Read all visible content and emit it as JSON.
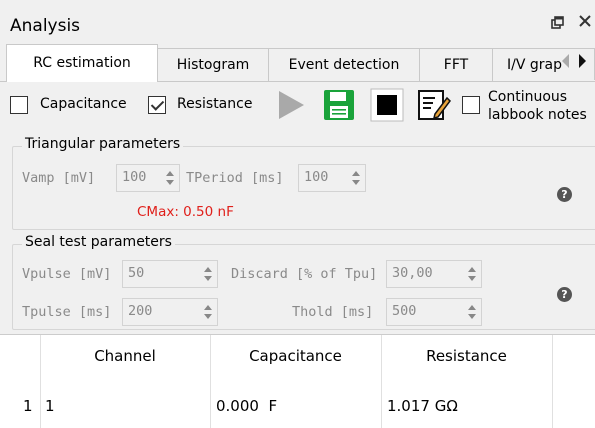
{
  "window": {
    "title": "Analysis",
    "float_icon": "float-icon",
    "close_icon": "close-icon"
  },
  "tabs": [
    {
      "label": "RC estimation",
      "active": true
    },
    {
      "label": "Histogram",
      "active": false
    },
    {
      "label": "Event detection",
      "active": false
    },
    {
      "label": "FFT",
      "active": false
    },
    {
      "label": "I/V grap",
      "active": false
    }
  ],
  "toolbar": {
    "capacitance_label": "Capacitance",
    "capacitance_checked": false,
    "resistance_label": "Resistance",
    "resistance_checked": true,
    "continuous_label_line1": "Continuous",
    "continuous_label_line2": "labbook notes",
    "continuous_checked": false
  },
  "triangular": {
    "title": "Triangular parameters",
    "vamp_label": "Vamp [mV]",
    "vamp_value": "100",
    "tperiod_label": "TPeriod [ms]",
    "tperiod_value": "100",
    "cmax_text": "CMax: 0.50 nF"
  },
  "seal": {
    "title": "Seal test parameters",
    "vpulse_label": "Vpulse [mV]",
    "vpulse_value": "50",
    "discard_label": "Discard [% of Tpu]",
    "discard_value": "30,00",
    "tpulse_label": "Tpulse [ms]",
    "tpulse_value": "200",
    "thold_label": "Thold [ms]",
    "thold_value": "500"
  },
  "table": {
    "headers": [
      "Channel",
      "Capacitance",
      "Resistance"
    ],
    "rows": [
      {
        "index": "1",
        "channel": "1",
        "capacitance": "0.000  F",
        "resistance": "1.017 GΩ"
      }
    ]
  },
  "colors": {
    "cmax_red": "#e0201b",
    "save_green": "#1aa33a",
    "play_gray": "#a9a9a9"
  }
}
